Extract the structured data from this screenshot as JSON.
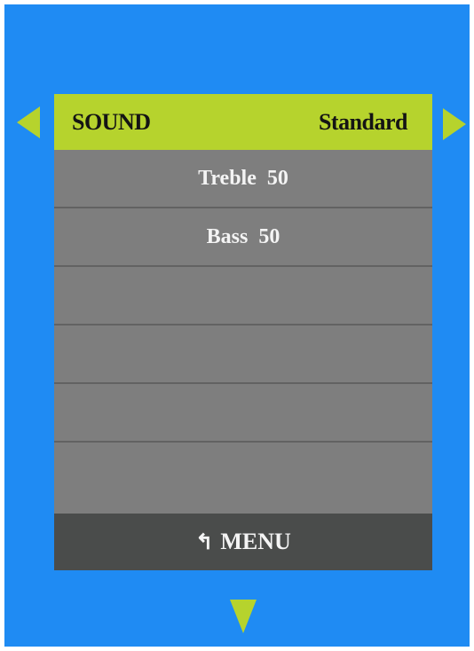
{
  "menu": {
    "title": "SOUND",
    "mode": "Standard",
    "items": [
      {
        "label": "Treble",
        "value": "50"
      },
      {
        "label": "Bass",
        "value": "50"
      },
      {
        "label": "",
        "value": ""
      },
      {
        "label": "",
        "value": ""
      },
      {
        "label": "",
        "value": ""
      },
      {
        "label": "",
        "value": ""
      }
    ]
  },
  "footer": {
    "return_glyph": "↰",
    "menu_label": "MENU"
  },
  "colors": {
    "background": "#1f8bf3",
    "accent": "#b6d32d",
    "panel": "#7e7e7e",
    "footer": "#4a4c4b"
  },
  "icons": [
    "arrow-left-icon",
    "arrow-right-icon",
    "arrow-down-icon",
    "return-icon"
  ]
}
